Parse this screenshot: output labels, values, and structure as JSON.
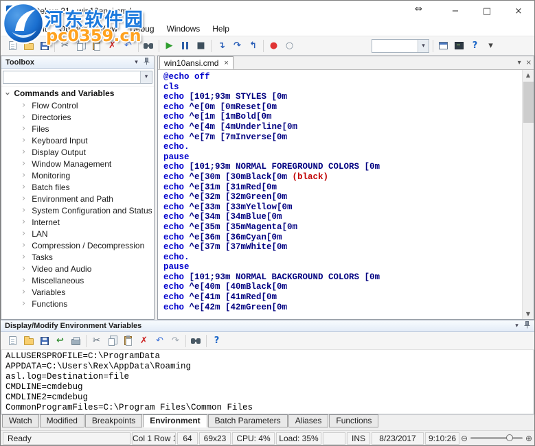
{
  "window": {
    "title": "CMDebug 21 - win10ansi.cmd",
    "minimize_glyph": "−",
    "maximize_glyph": "□",
    "close_glyph": "×",
    "drag_glyph": "⇔"
  },
  "watermark": {
    "site_name": "河东软件园",
    "site_url": "pc0359.cn"
  },
  "menubar": {
    "items": [
      "File",
      "Edit",
      "Options",
      "View",
      "Debug",
      "Windows",
      "Help"
    ]
  },
  "main_toolbar": {
    "icons": [
      "new-file",
      "open-folder",
      "save",
      "sep",
      "cut",
      "copy",
      "paste",
      "delete",
      "undo",
      "sep",
      "find",
      "sep",
      "run",
      "pause",
      "stop",
      "sep",
      "step-into",
      "step-over",
      "step-out",
      "sep",
      "record",
      "stop-recording",
      "spacer",
      "command-combo",
      "sep",
      "form-window",
      "console-output",
      "help",
      "overflow"
    ]
  },
  "toolbox": {
    "title": "Toolbox",
    "combo_value": "",
    "group_label": "Commands and Variables",
    "items": [
      "Flow Control",
      "Directories",
      "Files",
      "Keyboard Input",
      "Display Output",
      "Window Management",
      "Monitoring",
      "Batch files",
      "Environment and Path",
      "System Configuration and Status",
      "Internet",
      "LAN",
      "Compression / Decompression",
      "Tasks",
      "Video and Audio",
      "Miscellaneous",
      "Variables",
      "Functions"
    ]
  },
  "editor": {
    "tab_label": "win10ansi.cmd",
    "close_glyph": "×",
    "code_lines": [
      [
        [
          "@echo off",
          "kw"
        ]
      ],
      [
        [
          "cls",
          "kw"
        ]
      ],
      [
        [
          "echo",
          "kw"
        ],
        [
          " [101;93m STYLES [0m",
          "arg"
        ]
      ],
      [
        [
          "echo",
          "kw"
        ],
        [
          " ^e[0m [0mReset[0m",
          "arg"
        ]
      ],
      [
        [
          "echo",
          "kw"
        ],
        [
          " ^e[1m [1mBold[0m",
          "arg"
        ]
      ],
      [
        [
          "echo",
          "kw"
        ],
        [
          " ^e[4m [4mUnderline[0m",
          "arg"
        ]
      ],
      [
        [
          "echo",
          "kw"
        ],
        [
          " ^e[7m [7mInverse[0m",
          "arg"
        ]
      ],
      [
        [
          "echo.",
          "kw"
        ]
      ],
      [
        [
          "pause",
          "kw"
        ]
      ],
      [
        [
          "echo",
          "kw"
        ],
        [
          " [101;93m NORMAL FOREGROUND COLORS [0m",
          "arg"
        ]
      ],
      [
        [
          "echo",
          "kw"
        ],
        [
          " ^e[30m [30mBlack[0m ",
          "arg"
        ],
        [
          "(black)",
          "red"
        ]
      ],
      [
        [
          "echo",
          "kw"
        ],
        [
          " ^e[31m [31mRed[0m",
          "arg"
        ]
      ],
      [
        [
          "echo",
          "kw"
        ],
        [
          " ^e[32m [32mGreen[0m",
          "arg"
        ]
      ],
      [
        [
          "echo",
          "kw"
        ],
        [
          " ^e[33m [33mYellow[0m",
          "arg"
        ]
      ],
      [
        [
          "echo",
          "kw"
        ],
        [
          " ^e[34m [34mBlue[0m",
          "arg"
        ]
      ],
      [
        [
          "echo",
          "kw"
        ],
        [
          " ^e[35m [35mMagenta[0m",
          "arg"
        ]
      ],
      [
        [
          "echo",
          "kw"
        ],
        [
          " ^e[36m [36mCyan[0m",
          "arg"
        ]
      ],
      [
        [
          "echo",
          "kw"
        ],
        [
          " ^e[37m [37mWhite[0m",
          "arg"
        ]
      ],
      [
        [
          "echo.",
          "kw"
        ]
      ],
      [
        [
          "pause",
          "kw"
        ]
      ],
      [
        [
          "echo",
          "kw"
        ],
        [
          " [101;93m NORMAL BACKGROUND COLORS [0m",
          "arg"
        ]
      ],
      [
        [
          "echo",
          "kw"
        ],
        [
          " ^e[40m [40mBlack[0m",
          "arg"
        ]
      ],
      [
        [
          "echo",
          "kw"
        ],
        [
          " ^e[41m [41mRed[0m",
          "arg"
        ]
      ],
      [
        [
          "echo",
          "kw"
        ],
        [
          " ^e[42m [42mGreen[0m",
          "arg"
        ]
      ]
    ]
  },
  "env_panel": {
    "title": "Display/Modify Environment Variables",
    "toolbar_icons": [
      "new-file",
      "open-folder",
      "save",
      "revert",
      "print",
      "sep",
      "cut",
      "copy",
      "paste",
      "delete",
      "undo",
      "redo",
      "sep",
      "find",
      "sep",
      "help"
    ],
    "lines": [
      "ALLUSERSPROFILE=C:\\ProgramData",
      "APPDATA=C:\\Users\\Rex\\AppData\\Roaming",
      "asl.log=Destination=file",
      "CMDLINE=cmdebug",
      "CMDLINE2=cmdebug",
      "CommonProgramFiles=C:\\Program Files\\Common Files"
    ]
  },
  "bottom_tabs": {
    "tabs": [
      "Watch",
      "Modified",
      "Breakpoints",
      "Environment",
      "Batch Parameters",
      "Aliases",
      "Functions"
    ],
    "active": "Environment"
  },
  "statusbar": {
    "cells": [
      "Ready",
      "Col 1 Row 1",
      "64",
      "69x23",
      "CPU: 4%",
      "Load: 35%",
      "",
      "INS",
      "8/23/2017",
      "9:10:26"
    ]
  },
  "colors": {
    "keyword_blue": "#0000cc",
    "code_navy": "#000080",
    "alert_red": "#c00000",
    "record_red": "#e03434",
    "run_green": "#2f9e2f"
  }
}
